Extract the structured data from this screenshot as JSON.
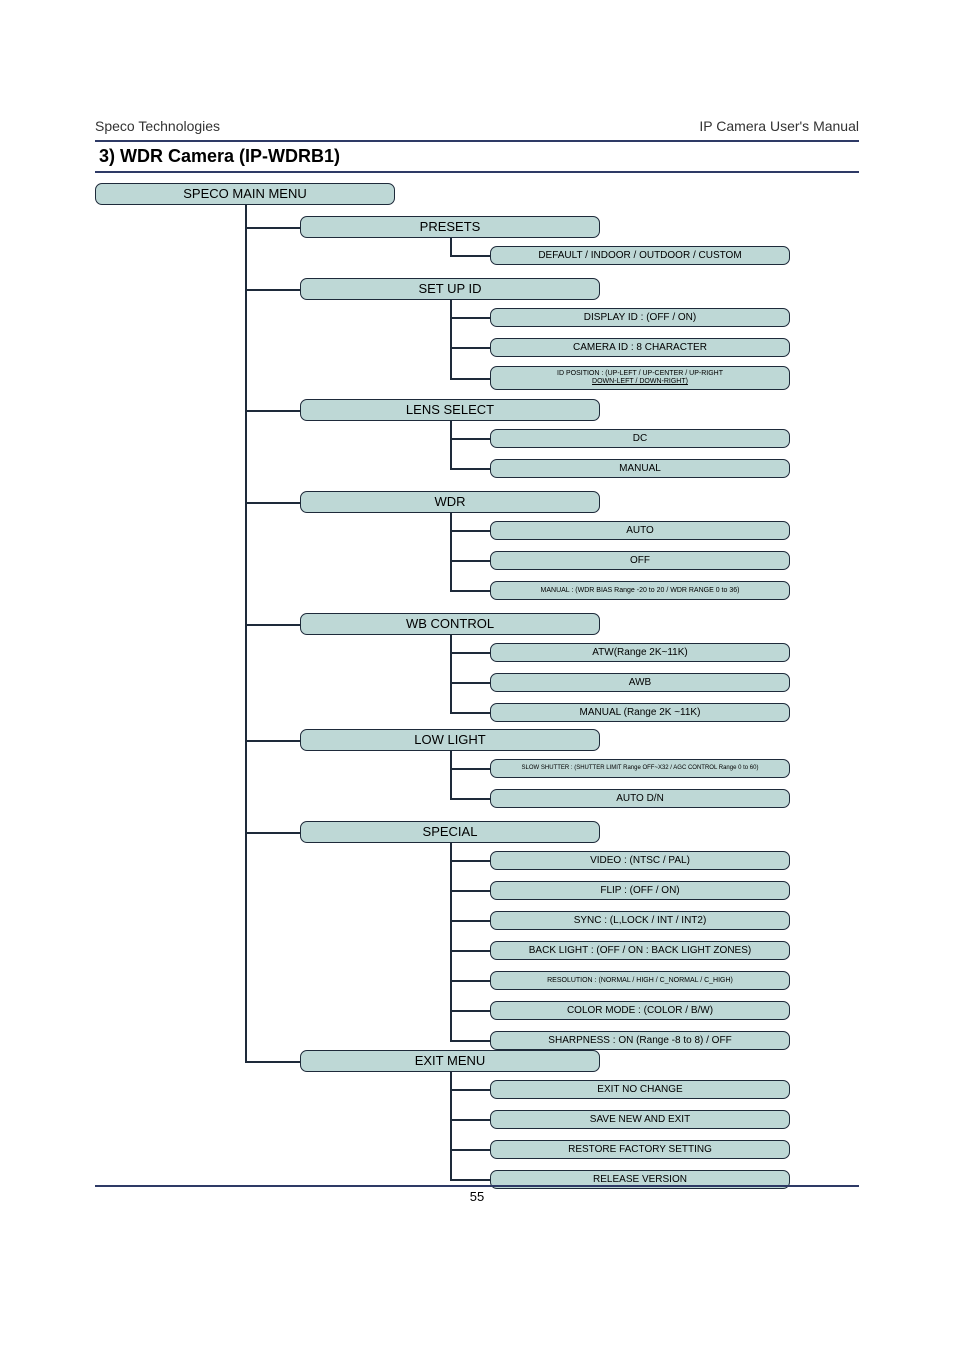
{
  "header": {
    "left": "Speco Technologies",
    "right": "IP Camera User's Manual"
  },
  "title": "3)   WDR Camera (IP-WDRB1)",
  "page_number": "55",
  "root": "SPECO MAIN MENU",
  "categories": {
    "presets": {
      "label": "PRESETS",
      "leaves": [
        "DEFAULT / INDOOR / OUTDOOR / CUSTOM"
      ]
    },
    "setupid": {
      "label": "SET UP ID",
      "leaves": [
        "DISPLAY ID : (OFF / ON)",
        "CAMERA ID : 8 CHARACTER"
      ],
      "multi": {
        "line1": "ID POSITION : (UP-LEFT / UP-CENTER / UP-RIGHT",
        "line2": "DOWN-LEFT / DOWN-RIGHT)"
      }
    },
    "lens": {
      "label": "LENS SELECT",
      "leaves": [
        "DC",
        "MANUAL"
      ]
    },
    "wdr": {
      "label": "WDR",
      "leaves": [
        "AUTO",
        "OFF",
        "MANUAL : (WDR BIAS Range -20 to 20 / WDR RANGE 0 to 36)"
      ]
    },
    "wb": {
      "label": "WB CONTROL",
      "leaves": [
        "ATW(Range 2K~11K)",
        "AWB",
        "MANUAL (Range 2K ~11K)"
      ]
    },
    "lowlight": {
      "label": "LOW LIGHT",
      "leaves": [
        "SLOW SHUTTER : (SHUTTER LIMIT Range OFF~X32 /   AGC CONTROL Range 0 to 60)",
        "AUTO D/N"
      ]
    },
    "special": {
      "label": "SPECIAL",
      "leaves": [
        "VIDEO : (NTSC / PAL)",
        "FLIP : (OFF / ON)",
        "SYNC : (L,LOCK / INT / INT2)",
        "BACK LIGHT : (OFF / ON : BACK LIGHT ZONES)",
        "RESOLUTION : (NORMAL / HIGH / C_NORMAL / C_HIGH)",
        "COLOR MODE : (COLOR / B/W)",
        "SHARPNESS : ON (Range -8 to 8) / OFF"
      ]
    },
    "exit": {
      "label": "EXIT MENU",
      "leaves": [
        "EXIT NO CHANGE",
        "SAVE NEW AND EXIT",
        "RESTORE FACTORY SETTING",
        "RELEASE VERSION"
      ]
    }
  },
  "chart_data": {
    "type": "table",
    "title": "WDR Camera (IP-WDRB1) OSD Menu Tree",
    "tree": {
      "SPECO MAIN MENU": {
        "PRESETS": [
          "DEFAULT / INDOOR / OUTDOOR / CUSTOM"
        ],
        "SET UP ID": [
          "DISPLAY ID : (OFF / ON)",
          "CAMERA ID : 8 CHARACTER",
          "ID POSITION : (UP-LEFT / UP-CENTER / UP-RIGHT DOWN-LEFT / DOWN-RIGHT)"
        ],
        "LENS SELECT": [
          "DC",
          "MANUAL"
        ],
        "WDR": [
          "AUTO",
          "OFF",
          "MANUAL : (WDR BIAS Range -20 to 20 / WDR RANGE 0 to 36)"
        ],
        "WB CONTROL": [
          "ATW(Range 2K~11K)",
          "AWB",
          "MANUAL (Range 2K ~11K)"
        ],
        "LOW LIGHT": [
          "SLOW SHUTTER : (SHUTTER LIMIT Range OFF~X32 / AGC CONTROL Range 0 to 60)",
          "AUTO D/N"
        ],
        "SPECIAL": [
          "VIDEO : (NTSC / PAL)",
          "FLIP : (OFF / ON)",
          "SYNC : (L,LOCK / INT / INT2)",
          "BACK LIGHT : (OFF / ON : BACK LIGHT ZONES)",
          "RESOLUTION : (NORMAL / HIGH / C_NORMAL / C_HIGH)",
          "COLOR MODE : (COLOR / B/W)",
          "SHARPNESS : ON (Range -8 to 8) / OFF"
        ],
        "EXIT MENU": [
          "EXIT NO CHANGE",
          "SAVE NEW AND EXIT",
          "RESTORE FACTORY SETTING",
          "RELEASE VERSION"
        ]
      }
    }
  }
}
